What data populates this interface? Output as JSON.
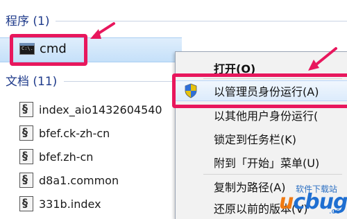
{
  "programs": {
    "header": "程序 (1)"
  },
  "cmd_result": {
    "icon_text": "C:\\.",
    "label": "cmd"
  },
  "documents": {
    "header": "文档 (11)",
    "items": [
      {
        "label": "index_aio1432604540"
      },
      {
        "label": "bfef.ck-zh-cn"
      },
      {
        "label": "bfef.zh-cn"
      },
      {
        "label": "d8a1.common"
      },
      {
        "label": "331b.index"
      }
    ]
  },
  "context_menu": {
    "items": [
      {
        "label": "打开(O)"
      },
      {
        "label": "以管理员身份运行(A)"
      },
      {
        "label": "以其他用户身份运行("
      },
      {
        "label": "锁定到任务栏(K)"
      },
      {
        "label": "附到「开始」菜单(U)"
      },
      {
        "label": "复制为路径(A)"
      },
      {
        "label": "还原以前的版本(V)"
      }
    ]
  },
  "watermark": {
    "top": "软件下载站",
    "logo": "ucbug",
    "logo_prefix": "u",
    "logo_rest": "cbug",
    "suffix": ".cc"
  },
  "colors": {
    "highlight": "#e8175d",
    "selection": "#dcebfc",
    "header_text": "#1e3a8a"
  },
  "icons": {
    "cmd": "command-prompt-icon",
    "document": "document-icon",
    "admin": "uac-shield-icon"
  }
}
